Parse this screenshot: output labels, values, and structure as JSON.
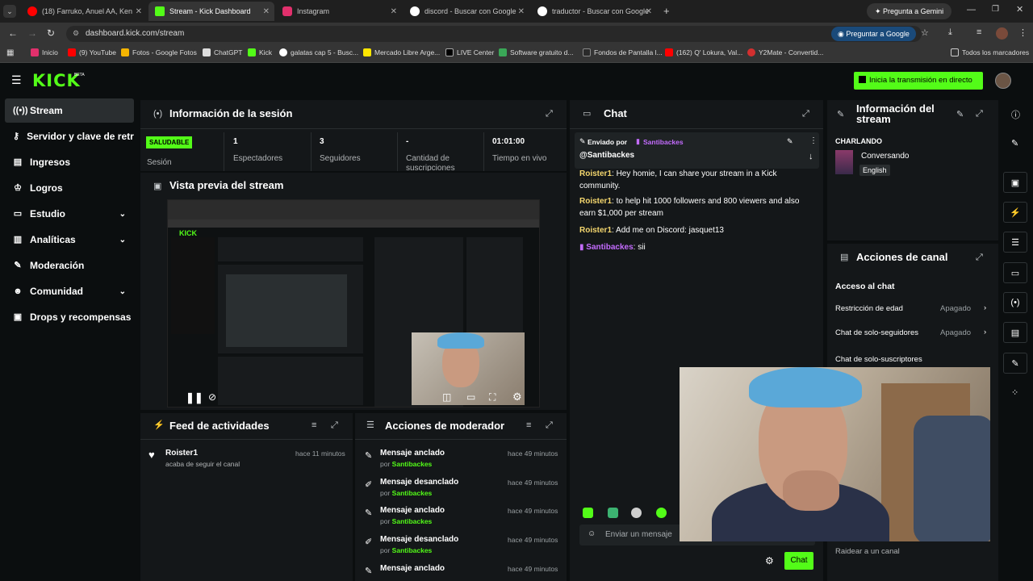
{
  "browser": {
    "tabs": [
      {
        "label": "(18) Farruko, Anuel AA, Ken",
        "color": "#ff0000"
      },
      {
        "label": "Stream - Kick Dashboard",
        "color": "#53fc18"
      },
      {
        "label": "Instagram",
        "color": "#e1306c"
      },
      {
        "label": "discord - Buscar con Google",
        "color": "#ffffff"
      },
      {
        "label": "traductor - Buscar con Google",
        "color": "#ffffff"
      }
    ],
    "gemini": "Pregunta a Gemini",
    "url": "dashboard.kick.com/stream",
    "ask_google": "Preguntar a Google",
    "bookmarks": [
      "Inicio",
      "(9) YouTube",
      "Fotos - Google Fotos",
      "ChatGPT",
      "Kick",
      "galatas cap 5 - Busc...",
      "Mercado Libre Arge...",
      "LIVE Center",
      "Software gratuito d...",
      "Fondos de Pantalla l...",
      "(162) Q' Lokura, Val...",
      "Y2Mate - Convertid..."
    ],
    "all_bookmarks": "Todos los marcadores"
  },
  "header": {
    "logo": "KICK",
    "beta": "BETA",
    "go_live": "Inicia la transmisión en directo"
  },
  "sidebar": {
    "items": [
      {
        "label": "Stream",
        "icon": "broadcast-icon",
        "chev": ""
      },
      {
        "label": "Servidor y clave de retransmisión",
        "icon": "key-icon",
        "chev": ""
      },
      {
        "label": "Ingresos",
        "icon": "money-icon",
        "chev": ""
      },
      {
        "label": "Logros",
        "icon": "trophy-icon",
        "chev": ""
      },
      {
        "label": "Estudio",
        "icon": "studio-icon",
        "chev": "⌄"
      },
      {
        "label": "Analíticas",
        "icon": "chart-icon",
        "chev": "⌄"
      },
      {
        "label": "Moderación",
        "icon": "wrench-icon",
        "chev": ""
      },
      {
        "label": "Comunidad",
        "icon": "people-icon",
        "chev": "⌄"
      },
      {
        "label": "Drops y recompensas",
        "icon": "gift-icon",
        "chev": ""
      }
    ]
  },
  "session": {
    "title": "Información de la sesión",
    "status": "SALUDABLE",
    "status_label": "Sesión",
    "stats": [
      {
        "value": "1",
        "label": "Espectadores"
      },
      {
        "value": "3",
        "label": "Seguidores"
      },
      {
        "value": "-",
        "label": "Cantidad de suscripciones"
      },
      {
        "value": "01:01:00",
        "label": "Tiempo en vivo"
      }
    ]
  },
  "preview": {
    "title": "Vista previa del stream"
  },
  "activity": {
    "title": "Feed de actividades",
    "items": [
      {
        "user": "Roister1",
        "text": "acaba de seguir el canal",
        "time": "hace 11 minutos"
      }
    ]
  },
  "modactions": {
    "title": "Acciones de moderador",
    "items": [
      {
        "action": "Mensaje anclado",
        "by": "por",
        "user": "Santibackes",
        "time": "hace 49 minutos"
      },
      {
        "action": "Mensaje desanclado",
        "by": "por",
        "user": "Santibackes",
        "time": "hace 49 minutos"
      },
      {
        "action": "Mensaje anclado",
        "by": "por",
        "user": "Santibackes",
        "time": "hace 49 minutos"
      },
      {
        "action": "Mensaje desanclado",
        "by": "por",
        "user": "Santibackes",
        "time": "hace 49 minutos"
      },
      {
        "action": "Mensaje anclado",
        "by": "",
        "user": "",
        "time": "hace 49 minutos"
      }
    ]
  },
  "chat": {
    "title": "Chat",
    "pinned_by": "Enviado por",
    "pinned_user": "Santibackes",
    "pinned_text": "@Santibackes",
    "messages": [
      {
        "user": "Roister1",
        "text": "Hey homie, I can share your stream in a Kick community."
      },
      {
        "user": "Roister1",
        "text": "to help hit 1000 followers and 800 viewers and also earn $1,000 per stream"
      },
      {
        "user": "Roister1",
        "text": "Add me on Discord: jasquet13"
      },
      {
        "user": "Santibackes",
        "text": "sii"
      }
    ],
    "placeholder": "Enviar un mensaje",
    "send": "Chat"
  },
  "streaminfo": {
    "title": "Información del stream",
    "category_label": "CHARLANDO",
    "category": "Conversando",
    "language": "English"
  },
  "channel": {
    "title": "Acciones de canal",
    "section": "Acceso al chat",
    "rows": [
      {
        "label": "Restricción de edad",
        "value": "Apagado"
      },
      {
        "label": "Chat de solo-seguidores",
        "value": "Apagado"
      },
      {
        "label": "Chat de solo-suscriptores",
        "value": ""
      }
    ],
    "raid": "Raidear a un canal"
  }
}
